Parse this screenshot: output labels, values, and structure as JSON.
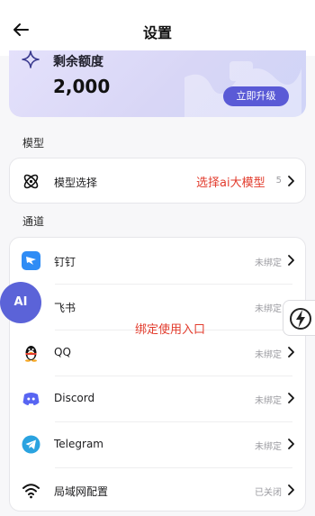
{
  "header": {
    "title": "设置"
  },
  "quota": {
    "label": "剩余额度",
    "value": "2,000",
    "upgrade_label": "立即升级"
  },
  "sections": {
    "model_title": "模型",
    "channel_title": "通道"
  },
  "model_row": {
    "label": "模型选择",
    "status": "5"
  },
  "channels": [
    {
      "label": "钉钉",
      "status": "未绑定"
    },
    {
      "label": "飞书",
      "status": "未绑定"
    },
    {
      "label": "QQ",
      "status": "未绑定"
    },
    {
      "label": "Discord",
      "status": "未绑定"
    },
    {
      "label": "Telegram",
      "status": "未绑定"
    },
    {
      "label": "局域网配置",
      "status": "已关闭"
    }
  ],
  "annotations": {
    "model_note": "选择ai大模型",
    "channel_note": "绑定使用入口"
  },
  "floating": {
    "ai_label": "AI"
  },
  "colors": {
    "accent": "#5a5ad6",
    "annotation": "#e23b2c",
    "dingtalk": "#2f8cf5",
    "discord": "#5865f2",
    "telegram": "#2aa3e0"
  },
  "icons": {
    "back": "arrow-left-icon",
    "quota": "sparkle-icon",
    "model": "atom-icon",
    "dingtalk": "dingtalk-icon",
    "feishu": "feishu-icon",
    "qq": "qq-penguin-icon",
    "discord": "discord-icon",
    "telegram": "telegram-icon",
    "lan": "wifi-icon",
    "chevron": "chevron-right-icon",
    "side_tab": "lightning-icon"
  }
}
